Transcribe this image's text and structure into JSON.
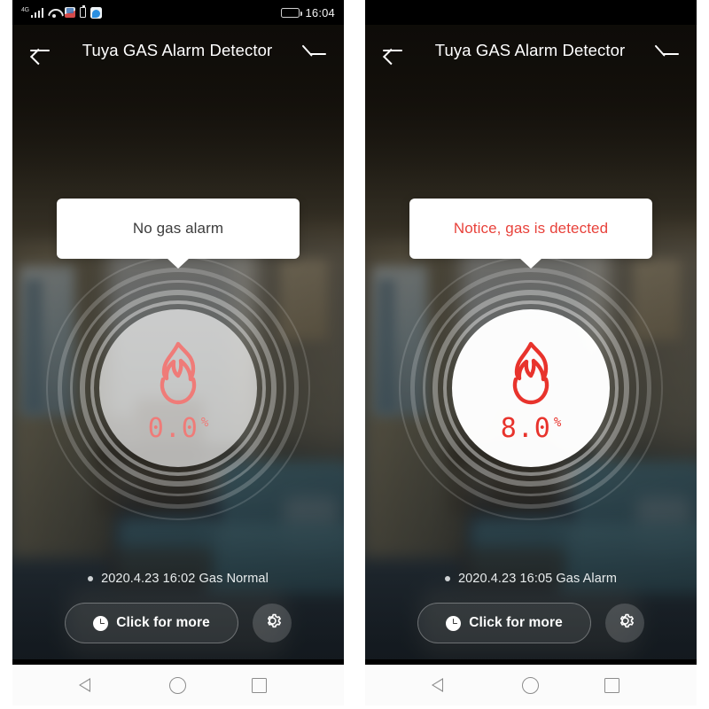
{
  "panels": [
    {
      "id": "normal",
      "status_bar": {
        "network_label": "4G",
        "time": "16:04",
        "icons": [
          "signal-bars-icon",
          "wifi-icon",
          "app-notification-icon",
          "battery-small-icon",
          "cloud-app-icon",
          "battery-icon"
        ],
        "battery_level_percent": 16
      },
      "header": {
        "back_label": "back-arrow-icon",
        "title": "Tuya GAS Alarm Detector",
        "edit_label": "edit-pencil-icon"
      },
      "tooltip": {
        "text": "No gas alarm",
        "state": "normal",
        "color": "#3c3c3c"
      },
      "gauge": {
        "icon": "flame-icon",
        "value": "0.0",
        "unit": "%",
        "color": "#ef7b78",
        "state": "normal"
      },
      "status_line": {
        "text": "2020.4.23 16:02 Gas Normal"
      },
      "actions": {
        "more_label": "Click for more",
        "more_icon": "clock-icon",
        "settings_icon": "gear-icon"
      },
      "nav_bar": {
        "back": "nav-back-triangle-icon",
        "home": "nav-home-circle-icon",
        "recents": "nav-recents-square-icon"
      }
    },
    {
      "id": "alarm",
      "status_bar": {
        "network_label": "",
        "time": "",
        "icons": [],
        "battery_level_percent": 0
      },
      "header": {
        "back_label": "back-arrow-icon",
        "title": "Tuya GAS Alarm Detector",
        "edit_label": "edit-pencil-icon"
      },
      "tooltip": {
        "text": "Notice, gas is detected",
        "state": "alarm",
        "color": "#e8423b"
      },
      "gauge": {
        "icon": "flame-icon",
        "value": "8.0",
        "unit": "%",
        "color": "#e8332c",
        "state": "alarm"
      },
      "status_line": {
        "text": "2020.4.23 16:05 Gas Alarm"
      },
      "actions": {
        "more_label": "Click for more",
        "more_icon": "clock-icon",
        "settings_icon": "gear-icon"
      },
      "nav_bar": {
        "back": "nav-back-triangle-icon",
        "home": "nav-home-circle-icon",
        "recents": "nav-recents-square-icon"
      }
    }
  ],
  "theme": {
    "alarm_red": "#e8332c",
    "normal_salmon": "#ef7b78",
    "card_white": "#ffffff",
    "header_text": "#ffffff"
  }
}
